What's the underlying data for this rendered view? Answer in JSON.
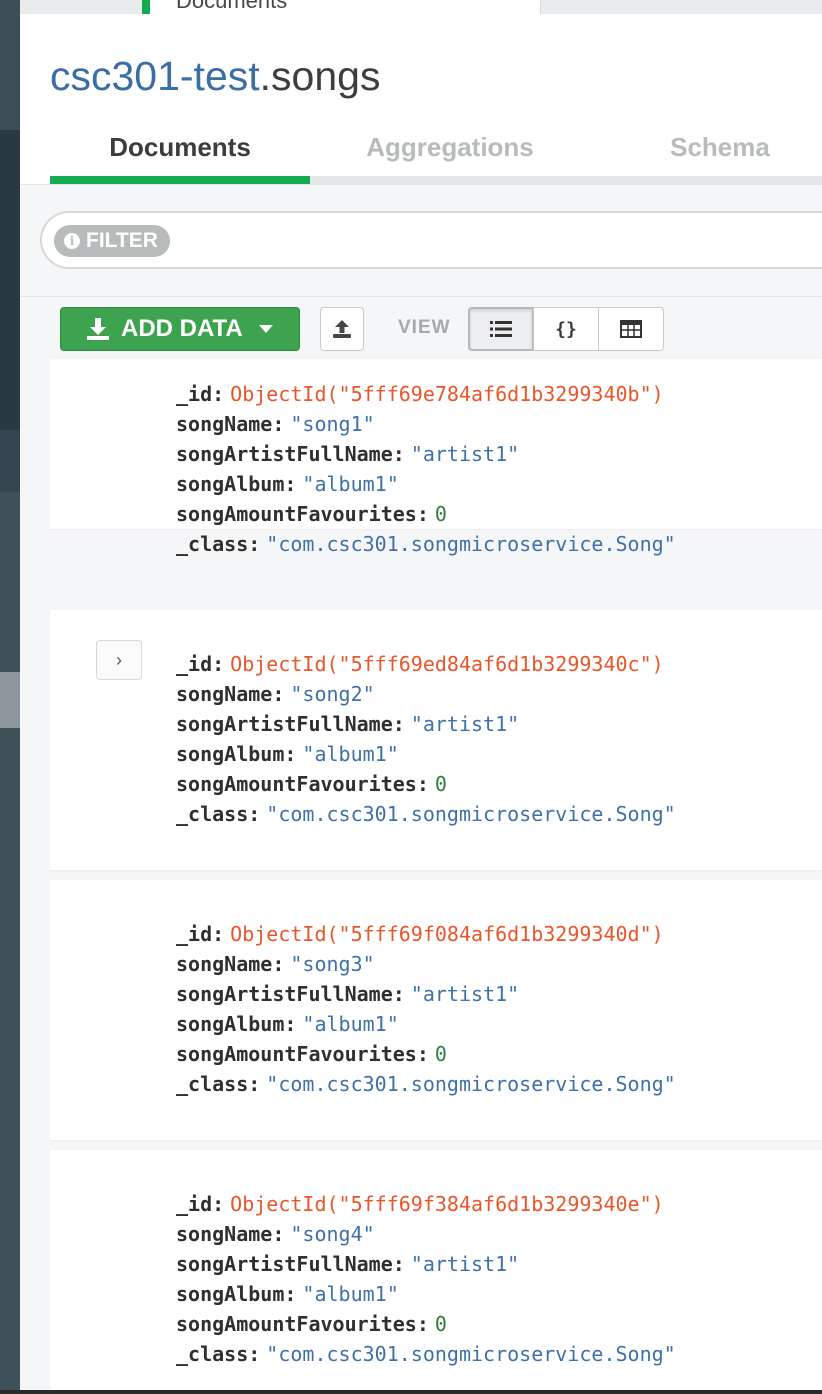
{
  "top_tab": {
    "label": "Documents"
  },
  "header": {
    "db_name": "csc301-test",
    "coll_name": ".songs"
  },
  "tabs": [
    {
      "label": "Documents",
      "active": true
    },
    {
      "label": "Aggregations",
      "active": false
    },
    {
      "label": "Schema",
      "active": false
    }
  ],
  "filter": {
    "pill_label": "FILTER",
    "icon": "info-icon",
    "value": ""
  },
  "toolbar": {
    "add_data_label": "ADD DATA",
    "add_data_icon": "download-icon",
    "upload_icon": "export-icon",
    "view_label": "VIEW",
    "view_modes": [
      "list-icon",
      "json-braces-icon",
      "table-icon"
    ],
    "json_braces_text": "{}",
    "active_view": "list"
  },
  "documents": [
    {
      "fields": [
        {
          "key": "_id",
          "value": "ObjectId(\"5fff69e784af6d1b3299340b\")",
          "type": "oid"
        },
        {
          "key": "songName",
          "value": "\"song1\"",
          "type": "str"
        },
        {
          "key": "songArtistFullName",
          "value": "\"artist1\"",
          "type": "str"
        },
        {
          "key": "songAlbum",
          "value": "\"album1\"",
          "type": "str"
        },
        {
          "key": "songAmountFavourites",
          "value": "0",
          "type": "num"
        },
        {
          "key": "_class",
          "value": "\"com.csc301.songmicroservice.Song\"",
          "type": "str"
        }
      ]
    },
    {
      "expand_glyph": "›",
      "fields": [
        {
          "key": "_id",
          "value": "ObjectId(\"5fff69ed84af6d1b3299340c\")",
          "type": "oid"
        },
        {
          "key": "songName",
          "value": "\"song2\"",
          "type": "str"
        },
        {
          "key": "songArtistFullName",
          "value": "\"artist1\"",
          "type": "str"
        },
        {
          "key": "songAlbum",
          "value": "\"album1\"",
          "type": "str"
        },
        {
          "key": "songAmountFavourites",
          "value": "0",
          "type": "num"
        },
        {
          "key": "_class",
          "value": "\"com.csc301.songmicroservice.Song\"",
          "type": "str"
        }
      ]
    },
    {
      "fields": [
        {
          "key": "_id",
          "value": "ObjectId(\"5fff69f084af6d1b3299340d\")",
          "type": "oid"
        },
        {
          "key": "songName",
          "value": "\"song3\"",
          "type": "str"
        },
        {
          "key": "songArtistFullName",
          "value": "\"artist1\"",
          "type": "str"
        },
        {
          "key": "songAlbum",
          "value": "\"album1\"",
          "type": "str"
        },
        {
          "key": "songAmountFavourites",
          "value": "0",
          "type": "num"
        },
        {
          "key": "_class",
          "value": "\"com.csc301.songmicroservice.Song\"",
          "type": "str"
        }
      ]
    },
    {
      "fields": [
        {
          "key": "_id",
          "value": "ObjectId(\"5fff69f384af6d1b3299340e\")",
          "type": "oid"
        },
        {
          "key": "songName",
          "value": "\"song4\"",
          "type": "str"
        },
        {
          "key": "songArtistFullName",
          "value": "\"artist1\"",
          "type": "str"
        },
        {
          "key": "songAlbum",
          "value": "\"album1\"",
          "type": "str"
        },
        {
          "key": "songAmountFavourites",
          "value": "0",
          "type": "num"
        },
        {
          "key": "_class",
          "value": "\"com.csc301.songmicroservice.Song\"",
          "type": "str"
        }
      ]
    }
  ],
  "colors": {
    "accent_green": "#13aa52",
    "button_green": "#3ea34f",
    "db_name_blue": "#3a6ea5",
    "string_value": "#3f71a8",
    "objectid_value": "#e8562a",
    "number_value": "#2e7d3a"
  }
}
